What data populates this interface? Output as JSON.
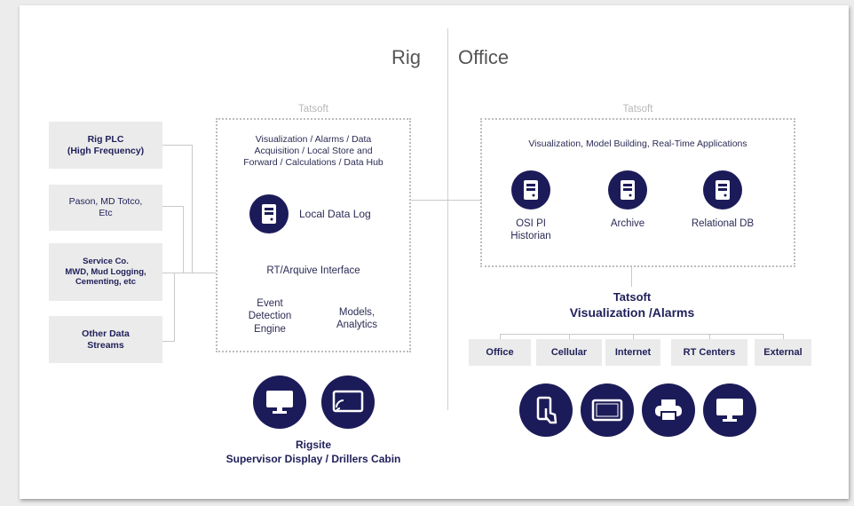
{
  "regions": {
    "rig": "Rig",
    "office": "Office"
  },
  "sources": [
    "Rig PLC\n(High Frequency)",
    "Pason, MD Totco,\nEtc",
    "Service Co.\nMWD, Mud Logging,\nCementing, etc",
    "Other Data\nStreams"
  ],
  "rig_box": {
    "vendor": "Tatsoft",
    "description": "Visualization / Alarms / Data\nAcquisition / Local Store and\nForward / Calculations / Data Hub",
    "local_log": "Local Data Log",
    "interface": "RT/Arquive Interface",
    "event": "Event\nDetection\nEngine",
    "models": "Models,\nAnalytics"
  },
  "office_box": {
    "vendor": "Tatsoft",
    "description": "Visualization, Model Building, Real-Time Applications",
    "items": [
      "OSI PI\nHistorian",
      "Archive",
      "Relational DB"
    ]
  },
  "office_viz": {
    "line1": "Tatsoft",
    "line2": "Visualization /Alarms"
  },
  "channels": [
    "Office",
    "Cellular",
    "Internet",
    "RT Centers",
    "External"
  ],
  "rigsite": {
    "line1": "Rigsite",
    "line2": "Supervisor Display / Drillers Cabin"
  },
  "icons": {
    "rig_display": [
      "monitor-icon",
      "cast-screen-icon"
    ],
    "office_devices": [
      "mobile-touch-icon",
      "tablet-icon",
      "printer-icon",
      "monitor-icon"
    ],
    "db": "database-server-icon"
  },
  "colors": {
    "accent": "#1c1b59",
    "source_bg": "#ebebeb",
    "dotted": "#bdbdbd"
  }
}
